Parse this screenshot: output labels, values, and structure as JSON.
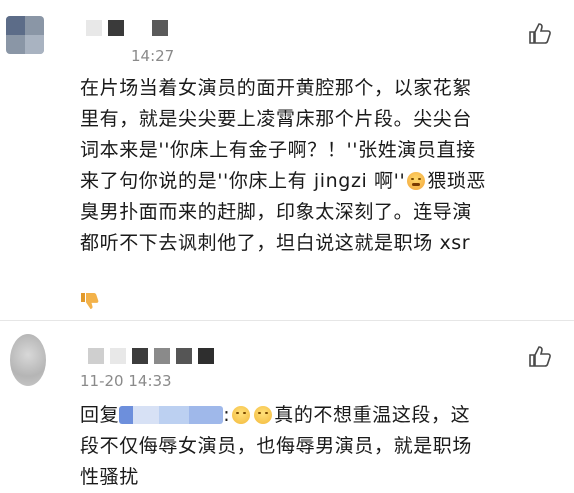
{
  "comments": [
    {
      "time": "14:27",
      "lines": [
        "在片场当着女演员的面开黄腔那个，以家花絮",
        "里有，就是尖尖要上凌霄床那个片段。尖尖台",
        "词本来是''你床上有金子啊？！''张姓演员直接",
        "来了句你说的是''你床上有 jingzi 啊''",
        "猥琐恶",
        "臭男扑面而来的赶脚，印象太深刻了。连导演",
        "都听不下去讽刺他了，坦白说这就是职场 xsr"
      ],
      "icons": [
        "avatar",
        "like-icon",
        "crying-emoji",
        "dislike-icon"
      ]
    },
    {
      "time": "11-20 14:33",
      "reply_prefix": "回复",
      "after_mention": ":",
      "line1_rest": "真的不想重温这段，这",
      "line2": "段不仅侮辱女演员，也侮辱男演员，就是职场",
      "line3": "性骚扰",
      "icons": [
        "avatar",
        "like-icon",
        "emoji",
        "emoji"
      ]
    }
  ]
}
